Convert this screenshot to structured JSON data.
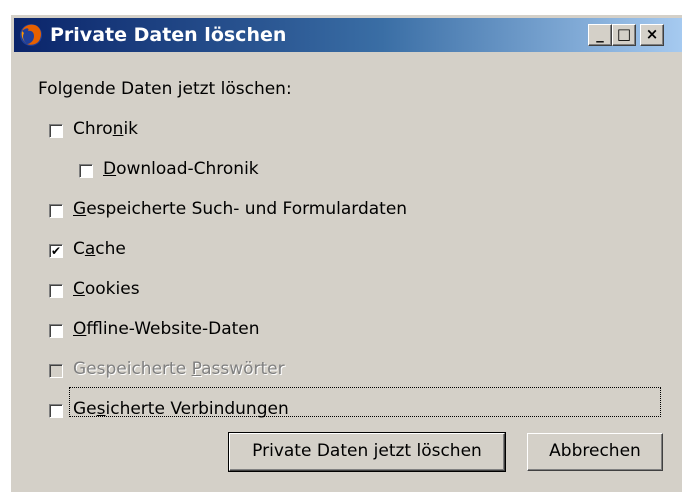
{
  "window": {
    "title": "Private Daten löschen",
    "icon": "firefox-icon",
    "controls": {
      "minimize": "_",
      "maximize": "□",
      "close": "×"
    }
  },
  "dialog": {
    "heading": "Folgende Daten jetzt löschen:",
    "options": [
      {
        "pre": "Chro",
        "accel": "n",
        "post": "ik",
        "checked": false,
        "enabled": true
      },
      {
        "pre": "",
        "accel": "D",
        "post": "ownload-Chronik",
        "checked": false,
        "enabled": true
      },
      {
        "pre": "",
        "accel": "G",
        "post": "espeicherte Such- und Formulardaten",
        "checked": false,
        "enabled": true
      },
      {
        "pre": "C",
        "accel": "a",
        "post": "che",
        "checked": true,
        "enabled": true
      },
      {
        "pre": "",
        "accel": "C",
        "post": "ookies",
        "checked": false,
        "enabled": true
      },
      {
        "pre": "",
        "accel": "O",
        "post": "ffline-Website-Daten",
        "checked": false,
        "enabled": true
      },
      {
        "pre": "Gespeicherte ",
        "accel": "P",
        "post": "asswörter",
        "checked": false,
        "enabled": false
      },
      {
        "pre": "Ge",
        "accel": "s",
        "post": "icherte Verbindungen",
        "checked": false,
        "enabled": true,
        "focused": true
      }
    ],
    "buttons": {
      "clear": "Private Daten jetzt löschen",
      "cancel": "Abbrechen"
    }
  },
  "check_glyph": "✔"
}
